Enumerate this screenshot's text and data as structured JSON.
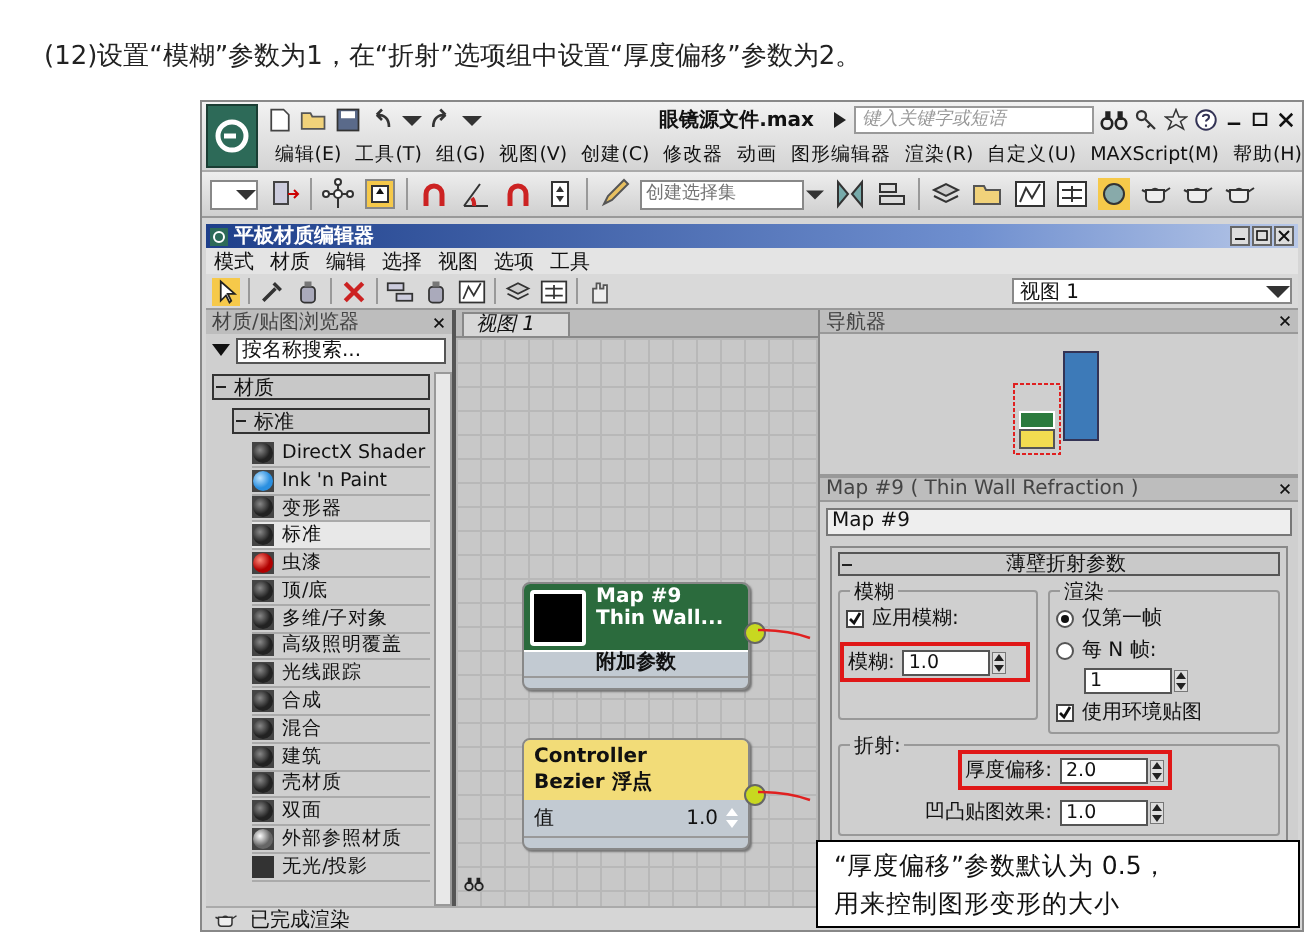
{
  "caption": "(12)设置“模糊”参数为1，在“折射”选项组中设置“厚度偏移”参数为2。",
  "app": {
    "title": "眼镜源文件.max",
    "search": {
      "placeholder": "键入关键字或短语"
    },
    "menu": [
      "编辑(E)",
      "工具(T)",
      "组(G)",
      "视图(V)",
      "创建(C)",
      "修改器",
      "动画",
      "图形编辑器",
      "渲染(R)",
      "自定义(U)",
      "MAXScript(M)",
      "帮助(H)"
    ],
    "selection_set": {
      "placeholder": "创建选择集"
    }
  },
  "editor": {
    "title": "平板材质编辑器",
    "menu": [
      "模式",
      "材质",
      "编辑",
      "选择",
      "视图",
      "选项",
      "工具"
    ],
    "view_select": "视图 1",
    "browser": {
      "title": "材质/贴图浏览器",
      "search": {
        "placeholder": "按名称搜索..."
      },
      "group": {
        "label": "材质",
        "expanded": true
      },
      "subgroup": {
        "label": "标准",
        "expanded": true
      },
      "items": [
        {
          "label": "DirectX Shader",
          "kind": "dark",
          "selected": false
        },
        {
          "label": "Ink 'n Paint",
          "kind": "blue",
          "selected": false
        },
        {
          "label": "变形器",
          "kind": "dark",
          "selected": false
        },
        {
          "label": "标准",
          "kind": "dark",
          "selected": true
        },
        {
          "label": "虫漆",
          "kind": "red",
          "selected": false
        },
        {
          "label": "顶/底",
          "kind": "dark",
          "selected": false
        },
        {
          "label": "多维/子对象",
          "kind": "dark",
          "selected": false
        },
        {
          "label": "高级照明覆盖",
          "kind": "dark",
          "selected": false
        },
        {
          "label": "光线跟踪",
          "kind": "dark",
          "selected": false
        },
        {
          "label": "合成",
          "kind": "dark",
          "selected": false
        },
        {
          "label": "混合",
          "kind": "dark",
          "selected": false
        },
        {
          "label": "建筑",
          "kind": "dark",
          "selected": false
        },
        {
          "label": "壳材质",
          "kind": "dark",
          "selected": false
        },
        {
          "label": "双面",
          "kind": "dark",
          "selected": false
        },
        {
          "label": "外部参照材质",
          "kind": "white",
          "selected": false
        },
        {
          "label": "无光/投影",
          "kind": "flat",
          "selected": false
        }
      ]
    },
    "view_tab": "视图 1",
    "nodes": [
      {
        "kind": "map",
        "title": "Map #9",
        "subtitle": "Thin Wall...",
        "footer": "附加参数"
      },
      {
        "kind": "controller",
        "title": "Controller",
        "subtitle": "Bezier 浮点",
        "param": {
          "label": "值",
          "value": "1.0"
        }
      }
    ],
    "navigator": {
      "title": "导航器"
    },
    "params": {
      "title": "Map #9 ( Thin Wall Refraction )",
      "name": "Map #9",
      "rollout": {
        "label": "薄壁折射参数",
        "expanded": true
      },
      "blur_group": {
        "title": "模糊",
        "apply_blur": {
          "label": "应用模糊:",
          "checked": true
        },
        "blur": {
          "label": "模糊:",
          "value": "1.0",
          "highlight": true
        }
      },
      "render_group": {
        "title": "渲染",
        "options": [
          {
            "label": "仅第一帧",
            "selected": true
          },
          {
            "label": "每 N 帧:",
            "selected": false
          }
        ],
        "n_frames": "1",
        "use_env_map": {
          "label": "使用环境贴图",
          "checked": true
        }
      },
      "refraction_group": {
        "title": "折射:",
        "thickness_offset": {
          "label": "厚度偏移:",
          "value": "2.0",
          "highlight": true
        },
        "bump_effect": {
          "label": "凹凸贴图效果:",
          "value": "1.0",
          "highlight": false
        }
      }
    },
    "status": "已完成渲染"
  },
  "callout": {
    "lines": [
      "“厚度偏移”参数默认为 0.5，",
      "用来控制图形变形的大小"
    ]
  }
}
